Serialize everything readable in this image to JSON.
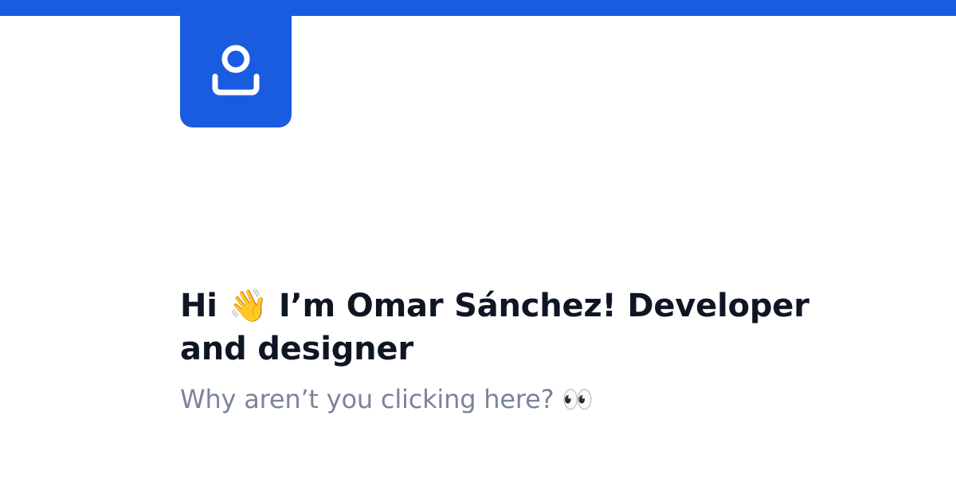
{
  "colors": {
    "brand": "#1a5ce0",
    "headline": "#0f1623",
    "subline": "#7b8499",
    "background": "#ffffff"
  },
  "logo": {
    "icon": "user-profile-icon"
  },
  "headline": {
    "greeting": "Hi",
    "wave_emoji": "👋",
    "text": "I’m Omar Sánchez! Developer and designer"
  },
  "subline": {
    "text": "Why aren’t you clicking here?",
    "eyes_emoji": "👀"
  }
}
